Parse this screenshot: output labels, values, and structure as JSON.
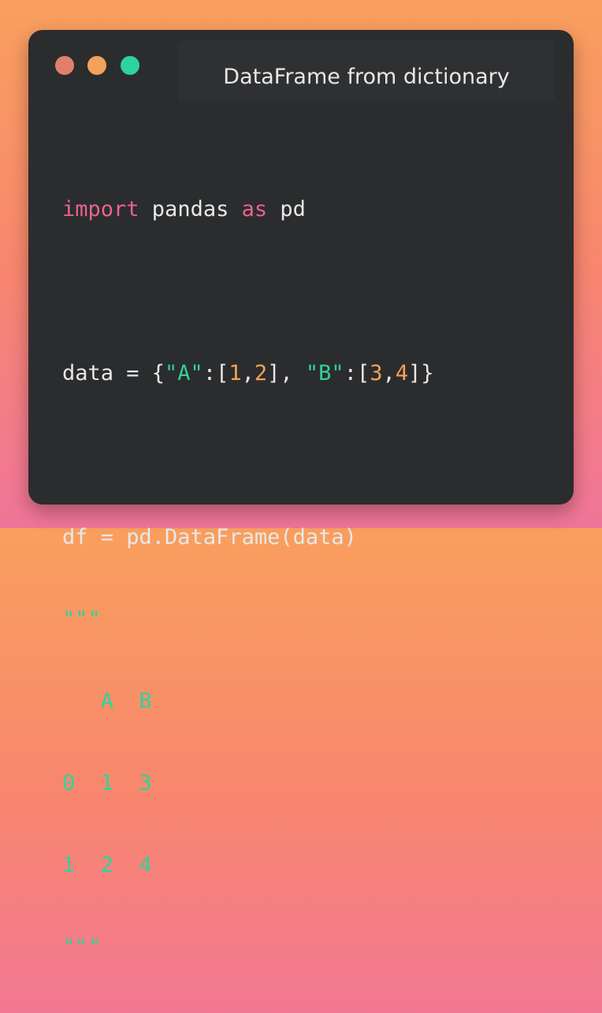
{
  "window": {
    "title": "DataFrame from dictionary",
    "controls": [
      "close-dot",
      "minimize-dot",
      "maximize-dot"
    ]
  },
  "code": {
    "line1": {
      "kw1": "import",
      "t1": " pandas ",
      "kw2": "as",
      "t2": " pd"
    },
    "line2": {
      "t1": "data = {",
      "s1": "\"A\"",
      "t2": ":[",
      "n1": "1",
      "t3": ",",
      "n2": "2",
      "t4": "], ",
      "s2": "\"B\"",
      "t5": ":[",
      "n3": "3",
      "t6": ",",
      "n4": "4",
      "t7": "]}"
    },
    "line3": "df = pd.DataFrame(data)",
    "docstring_open": "\"\"\"",
    "output_lines": [
      "   A  B",
      "0  1  3",
      "1  2  4"
    ],
    "docstring_close": "\"\"\""
  },
  "colors": {
    "background_top": "#f99f5e",
    "background_bottom": "#f0759a",
    "window": "#2b2c2e",
    "keyword": "#e9628f",
    "string": "#2fd39a",
    "number": "#f3a254",
    "text": "#e8e8e8"
  }
}
